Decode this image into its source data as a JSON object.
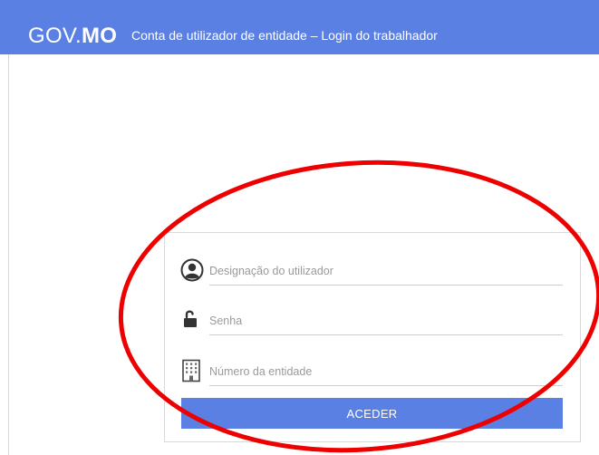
{
  "header": {
    "logo_gov": "GOV.",
    "logo_mo": "MO",
    "title": "Conta de utilizador de entidade – Login do trabalhador"
  },
  "form": {
    "username": {
      "placeholder": "Designação do utilizador",
      "value": "",
      "icon": "user-circle-icon"
    },
    "password": {
      "placeholder": "Senha",
      "value": "",
      "icon": "unlock-icon"
    },
    "entity": {
      "placeholder": "Número da entidade",
      "value": "",
      "icon": "building-icon"
    },
    "submit_label": "ACEDER"
  },
  "colors": {
    "brand": "#5b80e4",
    "annotation": "#ee0000"
  }
}
